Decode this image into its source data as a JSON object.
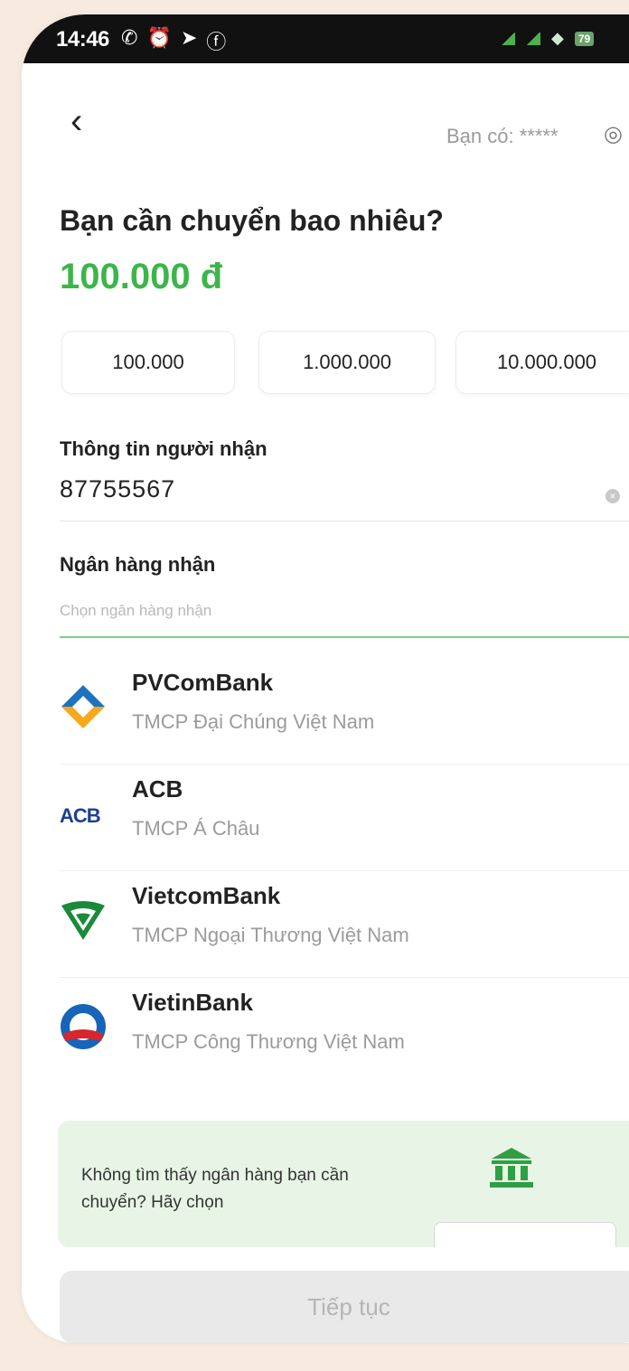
{
  "status_bar": {
    "time": "14:46",
    "battery": "79"
  },
  "header": {
    "back_icon": "chevron-left-icon",
    "balance_label": "Bạn có: *****",
    "eye_icon": "eye-icon"
  },
  "transfer": {
    "title": "Bạn cần chuyển bao nhiêu?",
    "amount": "100.000 đ",
    "quick_amounts": [
      "100.000",
      "1.000.000",
      "10.000.000"
    ]
  },
  "recipient": {
    "label": "Thông tin người nhận",
    "value": "87755567"
  },
  "bank": {
    "label": "Ngân hàng nhận",
    "placeholder": "Chọn ngân hàng nhận",
    "items": [
      {
        "name": "PVComBank",
        "desc": "TMCP Đại Chúng Việt Nam",
        "logo": "pvcombank-logo"
      },
      {
        "name": "ACB",
        "desc": "TMCP Á Châu",
        "logo": "acb-logo",
        "logo_text": "ACB"
      },
      {
        "name": "VietcomBank",
        "desc": "TMCP Ngoại Thương Việt Nam",
        "logo": "vietcombank-logo"
      },
      {
        "name": "VietinBank",
        "desc": "TMCP Công Thương Việt Nam",
        "logo": "vietinbank-logo"
      }
    ]
  },
  "notice": {
    "text": "Không tìm thấy ngân hàng bạn cần chuyển? Hãy chọn",
    "icon": "bank-building-icon"
  },
  "continue_button": "Tiếp tục",
  "colors": {
    "accent": "#3cb54a",
    "notice_bg": "#e8f5e6",
    "disabled_button": "#e9e9e9"
  }
}
